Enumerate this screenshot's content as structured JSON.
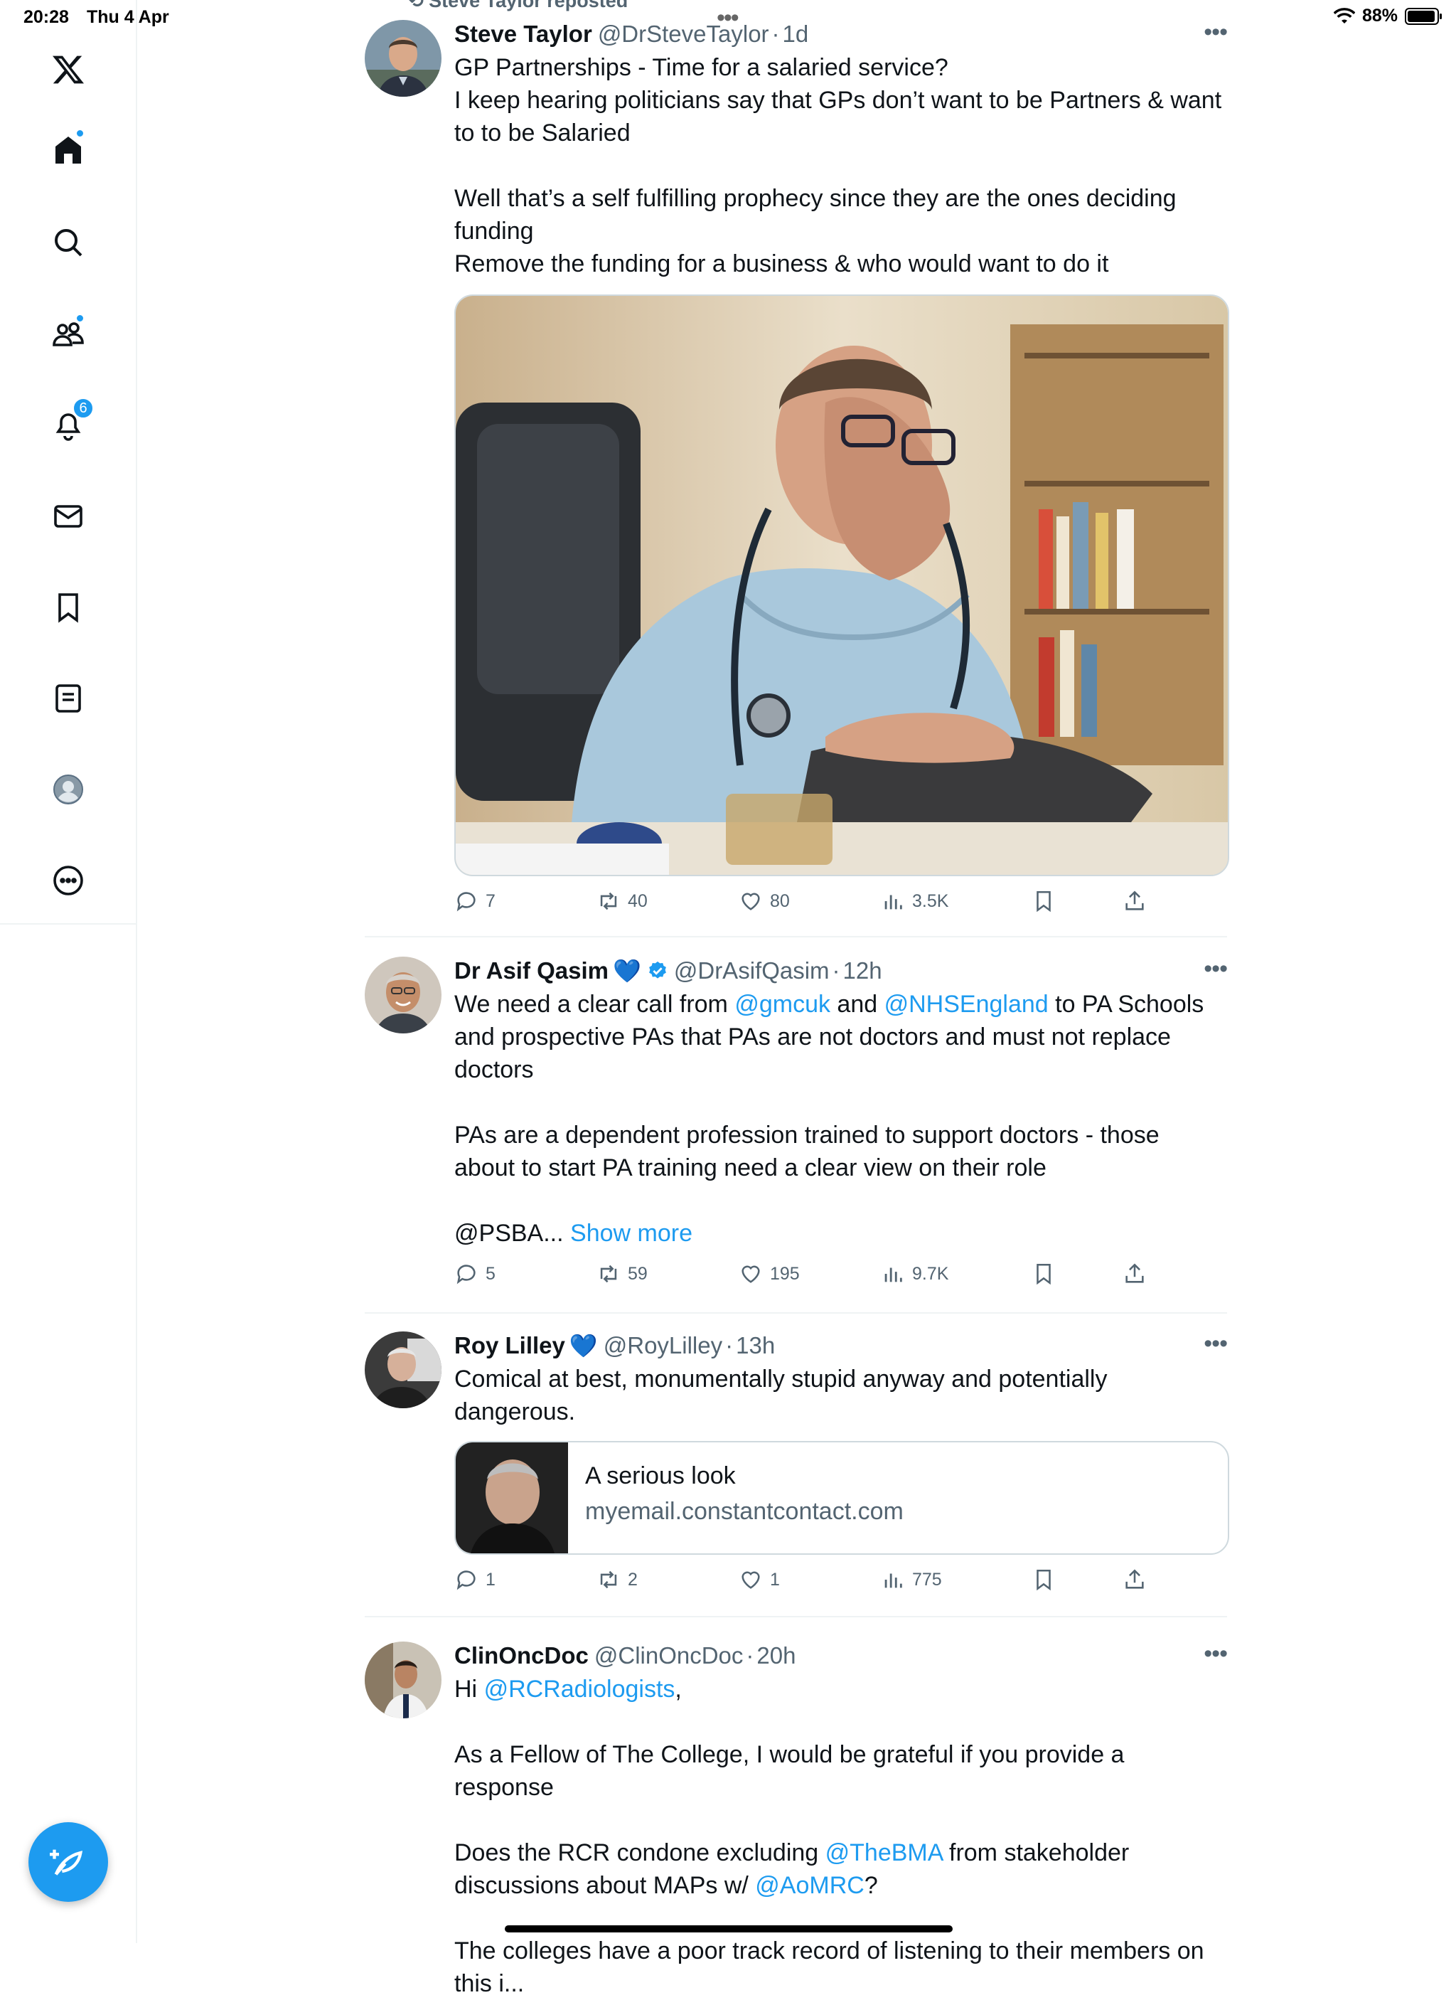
{
  "status_bar": {
    "time": "20:28",
    "date": "Thu 4 Apr",
    "battery": "88%"
  },
  "sidebar": {
    "items": [
      {
        "name": "x-logo"
      },
      {
        "name": "home"
      },
      {
        "name": "search"
      },
      {
        "name": "communities"
      },
      {
        "name": "notifications",
        "badge": "6"
      },
      {
        "name": "messages"
      },
      {
        "name": "bookmarks"
      },
      {
        "name": "lists"
      },
      {
        "name": "profile"
      },
      {
        "name": "more"
      }
    ]
  },
  "repost_label": "Steve Taylor reposted",
  "tweets": [
    {
      "name": "Steve Taylor",
      "handle": "@DrSteveTaylor",
      "time": "1d",
      "lines": [
        "GP Partnerships - Time for a salaried service?",
        "I keep hearing politicians say that GPs don’t want to be Partners & want",
        "to to be Salaried",
        "",
        "Well that’s a self fulfilling prophecy since they are the ones deciding",
        "funding",
        "Remove the funding for a business & who would want to do it"
      ],
      "stats": {
        "replies": "7",
        "reposts": "40",
        "likes": "80",
        "views": "3.5K"
      }
    },
    {
      "name": "Dr Asif Qasim",
      "handle": "@DrAsifQasim",
      "time": "12h",
      "line1_a": "We need a clear call from ",
      "line1_link1": "@gmcuk",
      "line1_b": " and ",
      "line1_link2": "@NHSEngland",
      "line1_c": " to PA Schools",
      "line2": "and prospective PAs that PAs are not doctors and must not replace",
      "line3": "doctors",
      "line4": "PAs are a dependent profession trained to support doctors - those",
      "line5": "about to start PA training need a clear view on their role",
      "line6": "@PSBA... ",
      "show_more": "Show more",
      "stats": {
        "replies": "5",
        "reposts": "59",
        "likes": "195",
        "views": "9.7K"
      }
    },
    {
      "name": "Roy Lilley",
      "handle": "@RoyLilley",
      "time": "13h",
      "line1": "Comical at best, monumentally stupid anyway and potentially",
      "line2": "dangerous.",
      "card": {
        "title": "A serious look",
        "domain": "myemail.constantcontact.com"
      },
      "stats": {
        "replies": "1",
        "reposts": "2",
        "likes": "1",
        "views": "775"
      }
    },
    {
      "name": "ClinOncDoc",
      "handle": "@ClinOncDoc",
      "time": "20h",
      "line1_a": "Hi ",
      "line1_link": "@RCRadiologists",
      "line1_b": ",",
      "line2": "As a Fellow of The College, I would be grateful if you provide a response",
      "line3_a": "Does the RCR condone excluding ",
      "line3_link": "@TheBMA",
      "line3_b": " from stakeholder",
      "line4_a": "discussions about MAPs w/ ",
      "line4_link": "@AoMRC",
      "line4_b": "?",
      "line5": "The colleges have a poor track record of listening to their members on",
      "line6": "this i..."
    }
  ],
  "accent": "#1d9bf0"
}
